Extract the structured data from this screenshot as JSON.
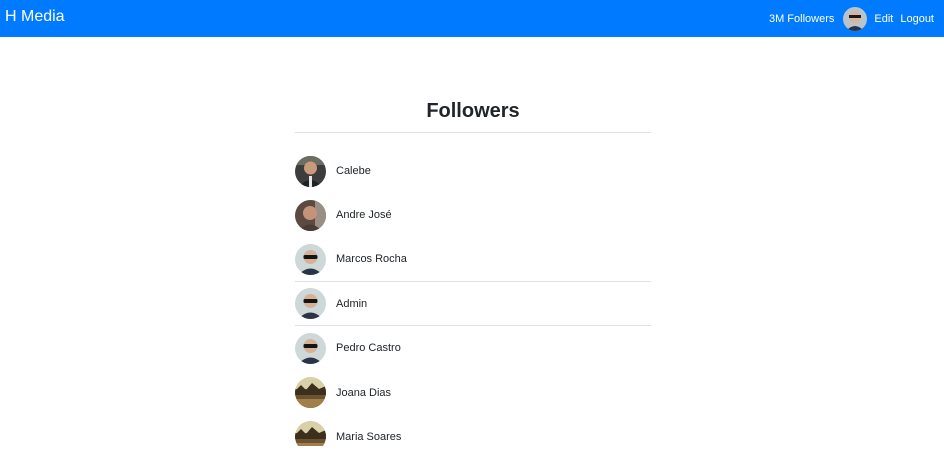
{
  "navbar": {
    "brand": "H Media",
    "followers_link": "3M Followers",
    "edit_link": "Edit",
    "logout_link": "Logout",
    "avatar_icon": "user-avatar",
    "background": "#007bff"
  },
  "page": {
    "title": "Followers"
  },
  "followers": [
    {
      "name": "Calebe",
      "avatar": "photo-man-suit"
    },
    {
      "name": "Andre José",
      "avatar": "photo-man-smiling"
    },
    {
      "name": "Marcos Rocha",
      "avatar": "photo-man-sunglasses"
    },
    {
      "name": "Admin",
      "avatar": "photo-man-sunglasses"
    },
    {
      "name": "Pedro Castro",
      "avatar": "photo-man-sunglasses"
    },
    {
      "name": "Joana Dias",
      "avatar": "photo-landscape"
    },
    {
      "name": "Maria Soares",
      "avatar": "photo-landscape"
    }
  ]
}
